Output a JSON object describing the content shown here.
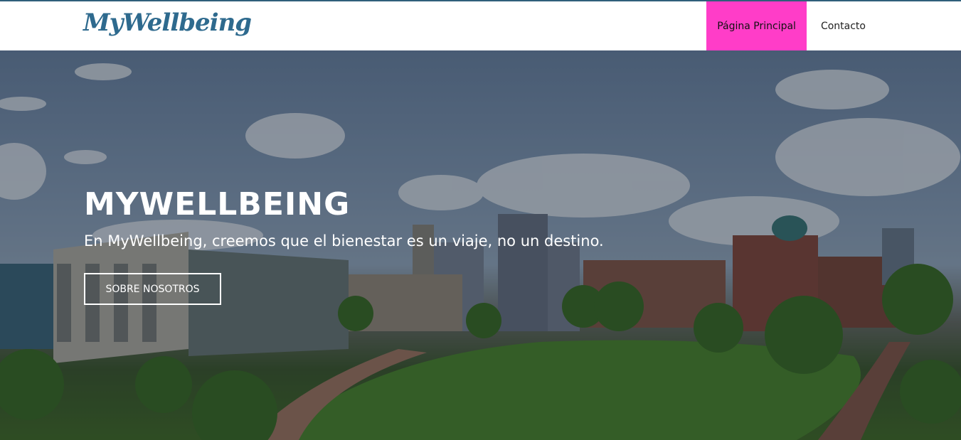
{
  "brand": {
    "logo_text": "MyWellbeing",
    "color": "#2e6a8e"
  },
  "nav": {
    "items": [
      {
        "label": "Página Principal",
        "active": true
      },
      {
        "label": "Contacto",
        "active": false
      }
    ],
    "active_color": "#ff3dc8"
  },
  "hero": {
    "title": "MYWELLBEING",
    "subtitle": "En MyWellbeing, creemos que el bienestar es un viaje, no un destino.",
    "button_label": "SOBRE NOSOTROS",
    "background_description": "campus-aerial-photo"
  }
}
